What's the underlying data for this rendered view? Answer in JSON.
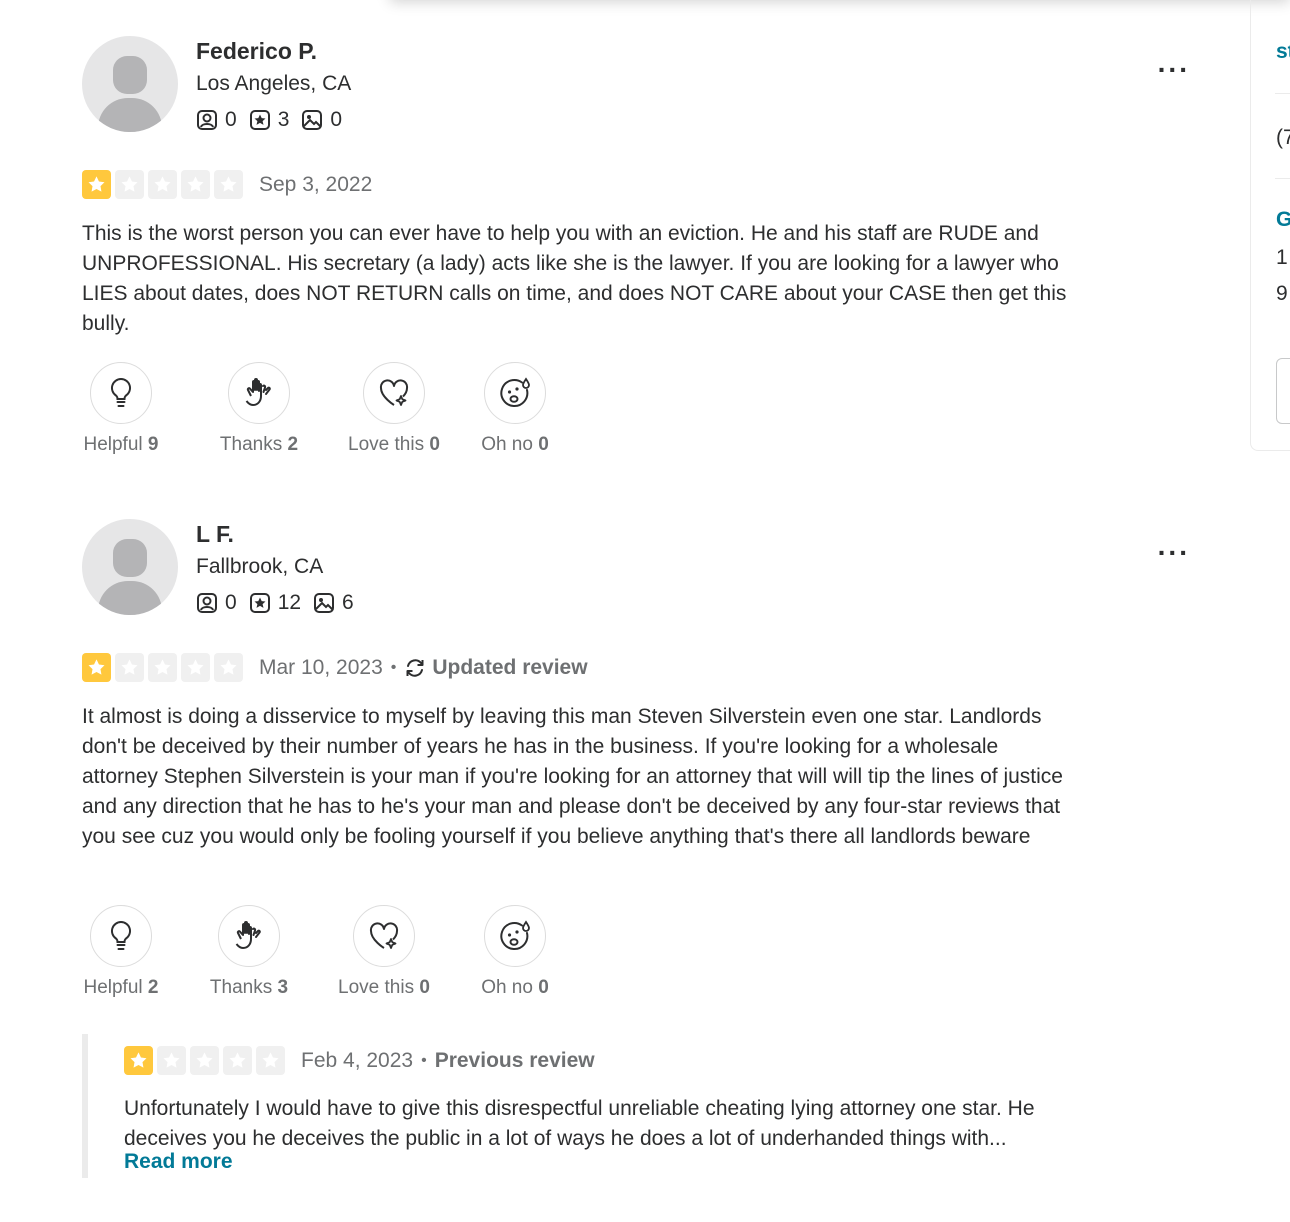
{
  "sidebar": {
    "link_fragment": "st",
    "text_fragment_1": "(7",
    "heading_fragment": "G",
    "text_fragment_2": "1",
    "text_fragment_3": "9"
  },
  "reviews": [
    {
      "user": {
        "name": "Federico P.",
        "location": "Los Angeles, CA",
        "friends": "0",
        "reviews": "3",
        "photos": "0"
      },
      "menu_label": "...",
      "rating": 1,
      "date": "Sep 3, 2022",
      "text": "This is the worst person you can ever have to help you with an eviction. He and his staff are RUDE and UNPROFESSIONAL. His secretary (a lady) acts like she is the lawyer. If you are looking for a lawyer who LIES about dates, does NOT RETURN calls on time, and does NOT CARE about your CASE then get this bully.",
      "reactions": [
        {
          "label": "Helpful",
          "count": "9",
          "icon": "lightbulb-icon"
        },
        {
          "label": "Thanks",
          "count": "2",
          "icon": "clapping-hands-icon"
        },
        {
          "label": "Love this",
          "count": "0",
          "icon": "heart-sparkle-icon"
        },
        {
          "label": "Oh no",
          "count": "0",
          "icon": "worried-face-icon"
        }
      ]
    },
    {
      "user": {
        "name": "L F.",
        "location": "Fallbrook, CA",
        "friends": "0",
        "reviews": "12",
        "photos": "6"
      },
      "menu_label": "...",
      "rating": 1,
      "date": "Mar 10, 2023",
      "separator": "•",
      "tag": "Updated review",
      "text": "It almost is doing a disservice to myself by leaving this man Steven Silverstein even one star. Landlords don't be deceived by their number of years he has in the business. If you're looking for a wholesale attorney Stephen Silverstein is your man if you're looking for an attorney that will will tip the lines of justice and any direction that he has to he's your man and please don't be deceived by any four-star reviews that you see cuz you would only be fooling yourself if you believe anything that's there all landlords beware",
      "reactions": [
        {
          "label": "Helpful",
          "count": "2",
          "icon": "lightbulb-icon"
        },
        {
          "label": "Thanks",
          "count": "3",
          "icon": "clapping-hands-icon"
        },
        {
          "label": "Love this",
          "count": "0",
          "icon": "heart-sparkle-icon"
        },
        {
          "label": "Oh no",
          "count": "0",
          "icon": "worried-face-icon"
        }
      ],
      "previous": {
        "rating": 1,
        "date": "Feb 4, 2023",
        "separator": "•",
        "tag": "Previous review",
        "text": "Unfortunately I would have to give this disrespectful unreliable cheating lying attorney one star. He deceives you he deceives the public in a lot of ways he does a lot of underhanded things with...",
        "read_more": "Read more"
      }
    }
  ],
  "colors": {
    "star": "#ffc83d",
    "link": "#027a97",
    "muted": "#6e7072",
    "text": "#2d2e2f"
  }
}
